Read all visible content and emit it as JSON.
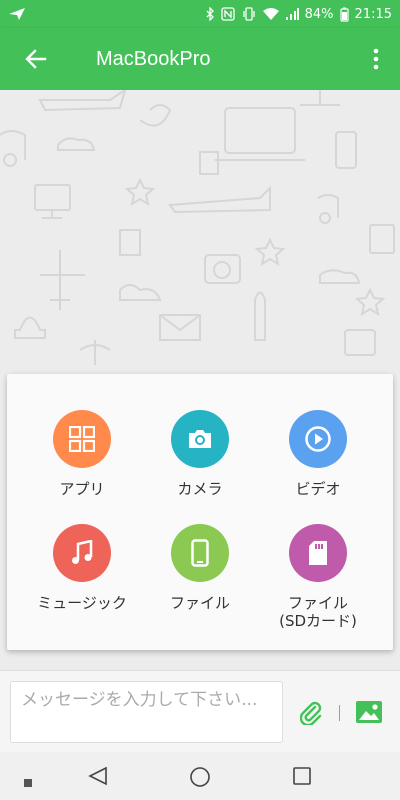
{
  "status": {
    "battery": "84%",
    "time": "21:15"
  },
  "app_bar": {
    "title": "MacBookPro"
  },
  "attach_options": [
    {
      "id": "app",
      "label": "アプリ",
      "color": "#ff8a4c",
      "icon": "apps-grid-icon"
    },
    {
      "id": "camera",
      "label": "カメラ",
      "color": "#26b4c5",
      "icon": "camera-icon"
    },
    {
      "id": "video",
      "label": "ビデオ",
      "color": "#5aa1ef",
      "icon": "play-icon"
    },
    {
      "id": "music",
      "label": "ミュージック",
      "color": "#ef6459",
      "icon": "music-note-icon"
    },
    {
      "id": "file",
      "label": "ファイル",
      "color": "#8bc952",
      "icon": "phone-file-icon"
    },
    {
      "id": "sd_file",
      "label": "ファイル\n(SDカード)",
      "color": "#c05aab",
      "icon": "sd-card-icon"
    }
  ],
  "composer": {
    "placeholder": "メッセージを入力して下さい..."
  },
  "colors": {
    "brand": "#43c158"
  }
}
